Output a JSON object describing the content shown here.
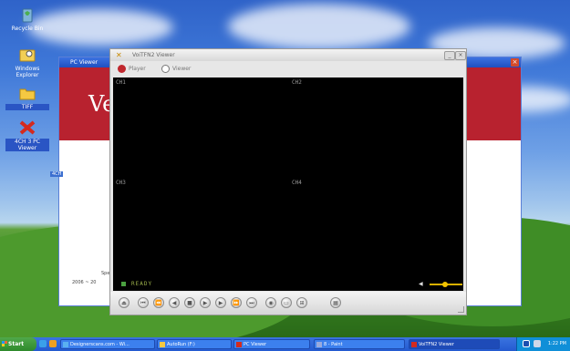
{
  "desktop": {
    "icons": [
      {
        "id": "recycle",
        "label": "Recycle Bin"
      },
      {
        "id": "explorer",
        "label": "Windows Explorer"
      },
      {
        "id": "folder",
        "label": "TIFF"
      },
      {
        "id": "pcviewer",
        "label": "4CH 3 PC Viewer"
      }
    ]
  },
  "bg_window": {
    "title": "PC Viewer",
    "banner_text": "Ve",
    "side_label": "4CH",
    "bottom_text_1": "Spe",
    "bottom_text_2": "2006 ~ 20"
  },
  "viewer": {
    "title": "VoiTFN2 Viewer",
    "menu": {
      "player": "Player",
      "viewer": "Viewer"
    },
    "channels": [
      "CH1",
      "CH2",
      "CH3",
      "CH4"
    ],
    "status": "READY",
    "colors": {
      "accent": "#c0272d",
      "status": "#9cb04a",
      "volume": "#f3c400"
    }
  },
  "taskbar": {
    "start": "Start",
    "tasks": [
      "Designerscans.com - Wi...",
      "AutoRun (F:)",
      "PC Viewer",
      "8 - Paint",
      "VoiTFN2 Viewer"
    ],
    "clock": "1:22 PM"
  }
}
